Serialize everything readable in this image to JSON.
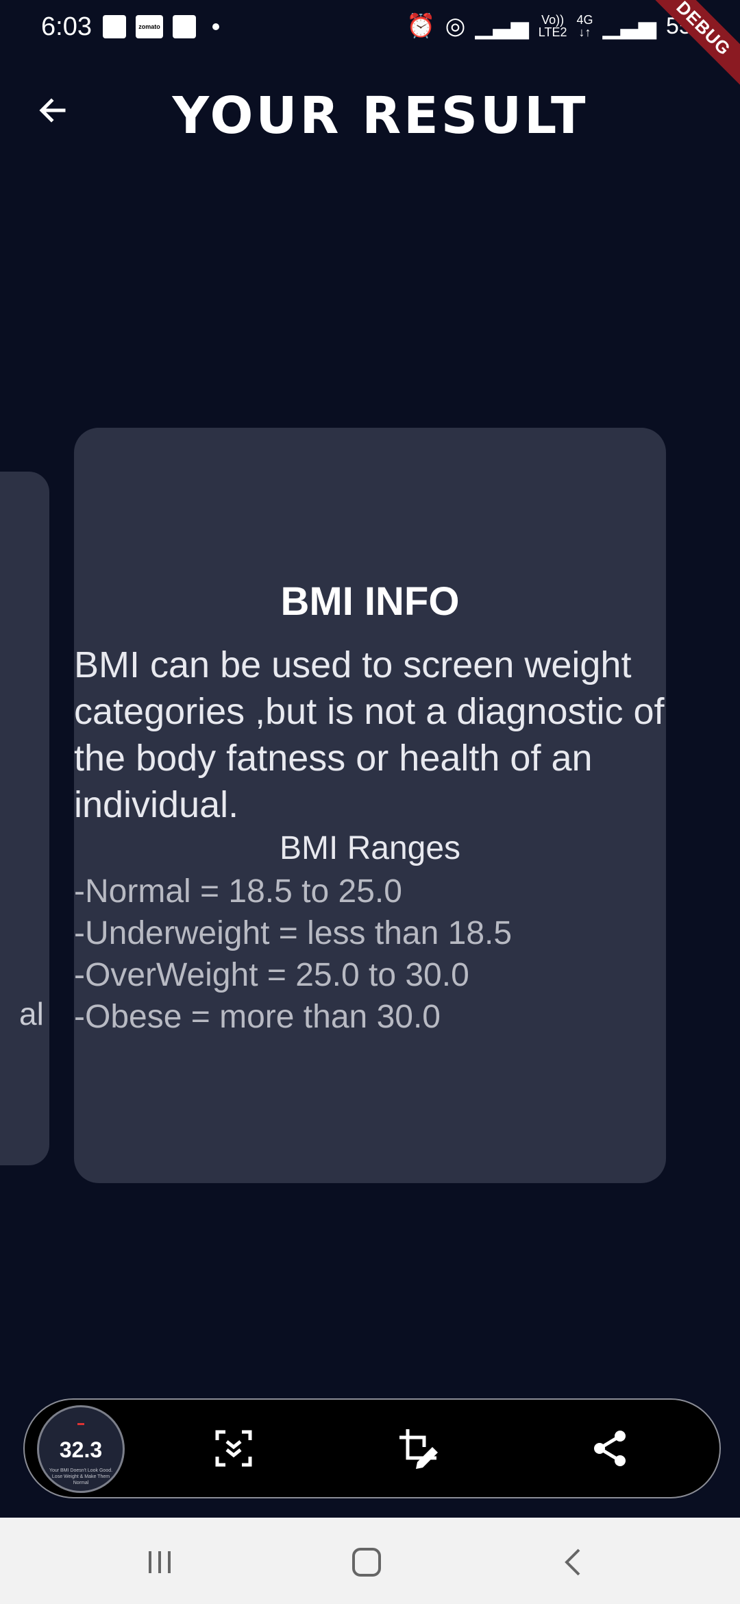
{
  "status": {
    "time": "6:03",
    "zomato": "zomato",
    "volte": "Vo))",
    "lte": "LTE2",
    "network": "4G",
    "battery": "55%"
  },
  "debug_banner": "DEBUG",
  "header": {
    "title": "YOUR RESULT"
  },
  "side_card": {
    "text": "al"
  },
  "card": {
    "title": "BMI INFO",
    "body": "BMI can be used to screen weight categories ,but is not a diagnostic of the body fatness or health of an individual.",
    "ranges_title": "BMI Ranges",
    "ranges": [
      "-Normal = 18.5 to 25.0",
      "-Underweight = less than 18.5",
      "-OverWeight = 25.0 to 30.0",
      "-Obese = more than 30.0"
    ]
  },
  "screenshot_toolbar": {
    "thumb_value": "32.3",
    "thumb_caption": "Your BMI Doesn't Look Good. Lose Weight & Make Them Normal",
    "icons": [
      "scroll-capture-icon",
      "crop-edit-icon",
      "share-icon"
    ]
  },
  "colors": {
    "background": "#090e21",
    "card": "#2d3245",
    "debug": "#8b1a22"
  }
}
